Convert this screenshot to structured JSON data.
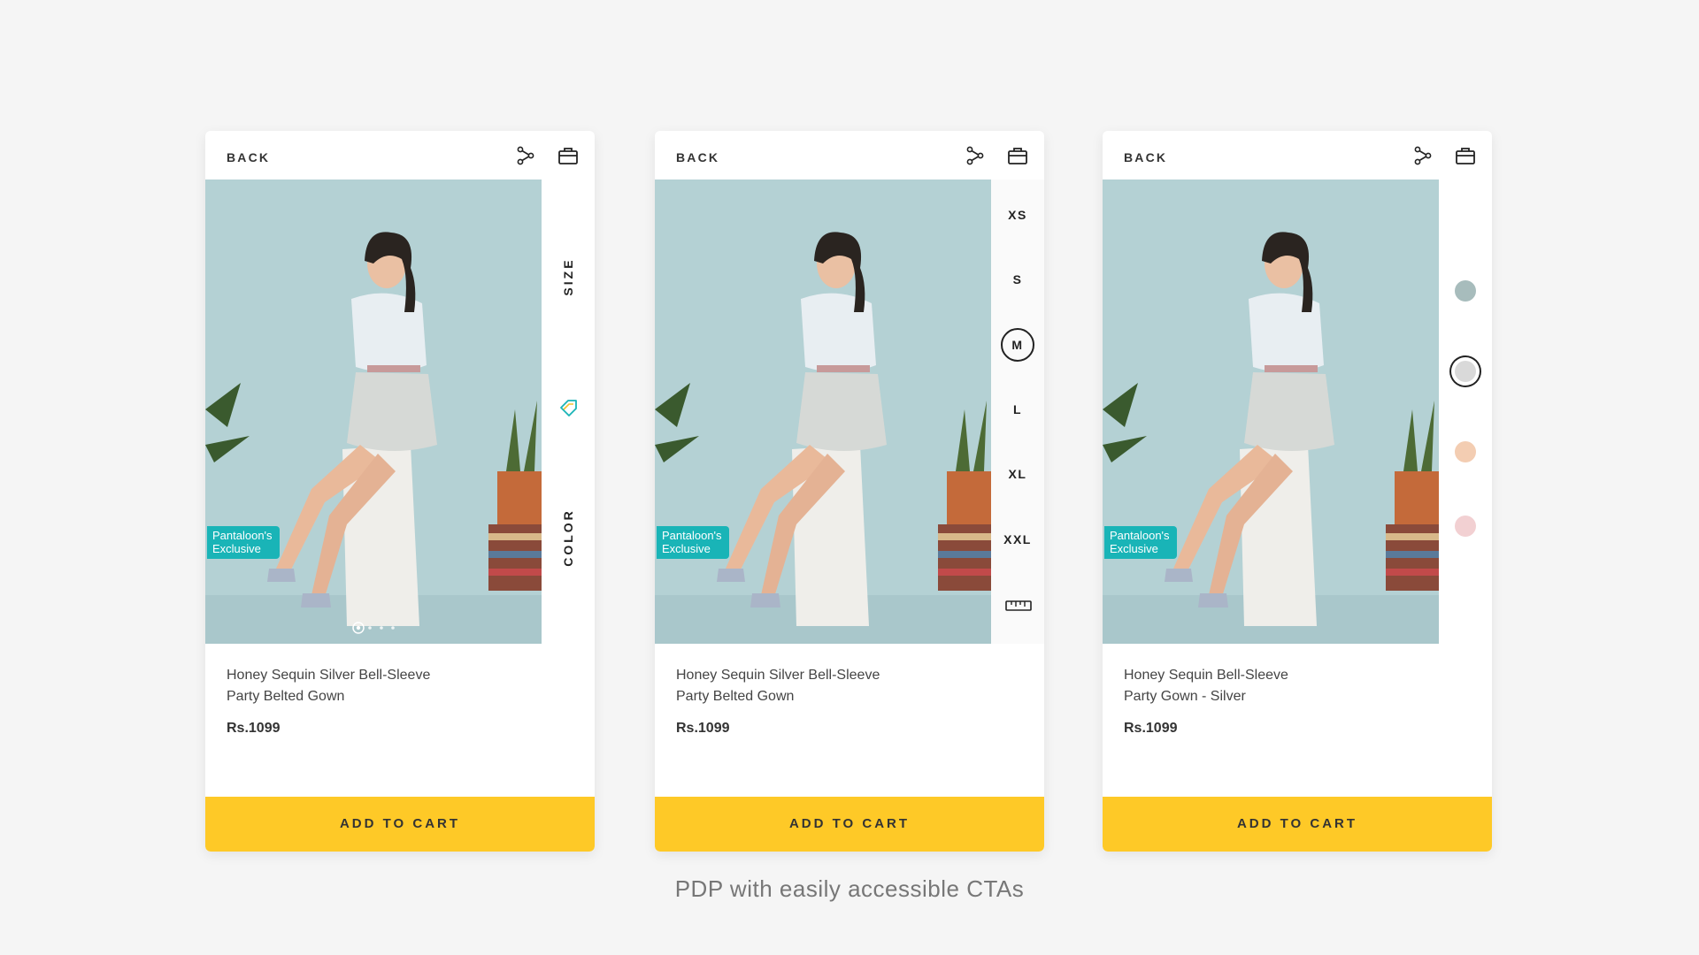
{
  "colors": {
    "background": "#f5f5f5",
    "card": "#ffffff",
    "cta": "#fec927",
    "badge": "#19b4b7",
    "photo_backdrop": "#b4d1d4"
  },
  "screens": [
    {
      "back_label": "BACK",
      "icons": [
        "share-icon",
        "shopping-bag-icon",
        "wishlist-tag-icon"
      ],
      "rail": {
        "size_label": "SIZE",
        "color_label": "COLOR"
      },
      "badge": [
        "Pantaloon's",
        "Exclusive"
      ],
      "carousel": {
        "pages": 4,
        "active": 1
      },
      "product": {
        "title_line1": "Honey Sequin Silver Bell-Sleeve",
        "title_line2": "Party Belted Gown",
        "price": "Rs.1099"
      },
      "cta_label": "ADD TO CART"
    },
    {
      "back_label": "BACK",
      "icons": [
        "share-icon",
        "shopping-bag-icon",
        "ruler-icon"
      ],
      "sizes": [
        "XS",
        "S",
        "M",
        "L",
        "XL",
        "XXL"
      ],
      "selected_size": "M",
      "badge": [
        "Pantaloon's",
        "Exclusive"
      ],
      "product": {
        "title_line1": "Honey Sequin Silver Bell-Sleeve",
        "title_line2": "Party Belted Gown",
        "price": "Rs.1099"
      },
      "cta_label": "ADD TO CART"
    },
    {
      "back_label": "BACK",
      "icons": [
        "share-icon",
        "shopping-bag-icon"
      ],
      "swatches": [
        "#a7bcbc",
        "#d9d9d9",
        "#f3cdb2",
        "#f2d0d2"
      ],
      "selected_swatch": 1,
      "badge": [
        "Pantaloon's",
        "Exclusive"
      ],
      "product": {
        "title_line1": "Honey Sequin Bell-Sleeve",
        "title_line2": "Party Gown - Silver",
        "price": "Rs.1099"
      },
      "cta_label": "ADD TO CART"
    }
  ],
  "caption": "PDP with easily accessible CTAs"
}
